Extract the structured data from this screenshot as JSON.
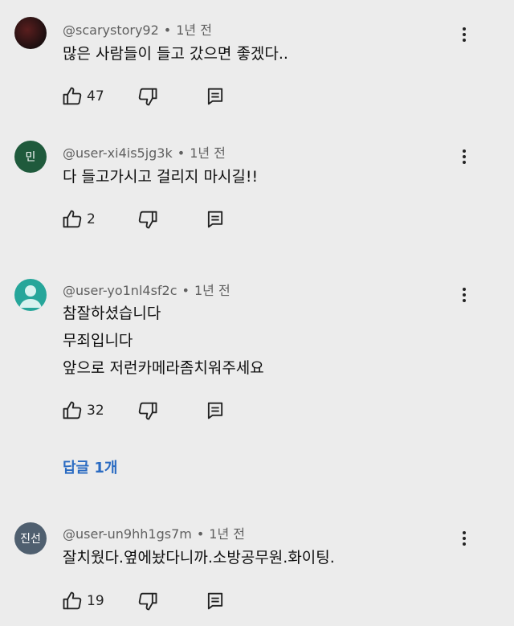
{
  "comments": [
    {
      "handle": "@scarystory92",
      "time": "1년 전",
      "lines": [
        "많은 사람들이 들고 갔으면 좋겠다.."
      ],
      "likes": "47",
      "avatar_text": "",
      "avatar_color": "#2a1a1a"
    },
    {
      "handle": "@user-xi4is5jg3k",
      "time": "1년 전",
      "lines": [
        "다 들고가시고 걸리지 마시길!!"
      ],
      "likes": "2",
      "avatar_text": "민",
      "avatar_color": "#1f5a3c"
    },
    {
      "handle": "@user-yo1nl4sf2c",
      "time": "1년 전",
      "lines": [
        "참잘하셨습니다",
        "무죄입니다",
        "앞으로 저런카메라좀치워주세요"
      ],
      "likes": "32",
      "avatar_text": "",
      "avatar_color": "#26a69a",
      "replies_label": "답글 1개"
    },
    {
      "handle": "@user-un9hh1gs7m",
      "time": "1년 전",
      "lines": [
        "잘치웠다.옆에놨다니까.소방공무원.화이팅."
      ],
      "likes": "19",
      "avatar_text": "진선",
      "avatar_color": "#4f5f6f"
    }
  ],
  "meta_separator": "•",
  "icons": {
    "like": "thumbs-up-icon",
    "dislike": "thumbs-down-icon",
    "reply": "reply-icon",
    "more": "more-vert-icon"
  },
  "colors": {
    "background": "#ececec",
    "meta_text": "#606060",
    "replies_link": "#2a6bc2"
  }
}
